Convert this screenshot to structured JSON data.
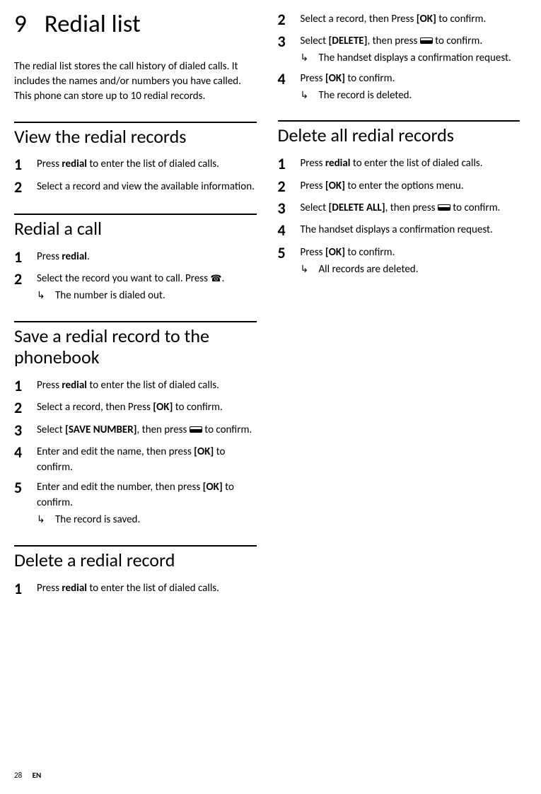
{
  "chapter": {
    "num": "9",
    "title": "Redial list"
  },
  "intro": "The redial list stores the call history of dialed calls. It includes the names and/or numbers you have called. This phone can store up to 10 redial records.",
  "s_view": {
    "title": "View the redial records",
    "step1_a": "Press ",
    "step1_b": "redial",
    "step1_c": " to enter the list of dialed calls.",
    "step2": "Select a record and view the available information."
  },
  "s_redial": {
    "title": "Redial a call",
    "step1_a": "Press ",
    "step1_b": "redial",
    "step1_c": ".",
    "step2": "Select the record you want to call. Press ",
    "step2_end": ".",
    "res": "The number is dialed out."
  },
  "s_save": {
    "title": "Save a redial record to the phonebook",
    "step1_a": "Press ",
    "step1_b": "redial",
    "step1_c": " to enter the list of dialed calls.",
    "step2_a": "Select a record, then Press ",
    "step2_b": "[OK]",
    "step2_c": " to confirm.",
    "step3_a": "Select ",
    "step3_b": "[SAVE NUMBER]",
    "step3_c": ", then press ",
    "step3_d": " to confirm.",
    "step4_a": "Enter and edit the name, then press ",
    "step4_b": "[OK]",
    "step4_c": " to confirm.",
    "step5_a": "Enter and edit the number, then press ",
    "step5_b": "[OK]",
    "step5_c": " to confirm.",
    "res": "The record is saved."
  },
  "s_del": {
    "title": "Delete a redial record",
    "step1_a": "Press ",
    "step1_b": "redial",
    "step1_c": " to enter the list of dialed calls.",
    "step2_a": "Select a record, then Press ",
    "step2_b": "[OK]",
    "step2_c": " to confirm.",
    "step3_a": "Select ",
    "step3_b": "[DELETE]",
    "step3_c": ", then press ",
    "step3_d": " to confirm.",
    "res3": "The handset displays a confirmation request.",
    "step4_a": "Press ",
    "step4_b": "[OK]",
    "step4_c": " to confirm.",
    "res4": "The record is deleted."
  },
  "s_delall": {
    "title": "Delete all redial records",
    "step1_a": "Press ",
    "step1_b": "redial",
    "step1_c": " to enter the list of dialed calls.",
    "step2_a": "Press ",
    "step2_b": "[OK]",
    "step2_c": " to enter the options menu.",
    "step3_a": "Select ",
    "step3_b": "[DELETE ALL]",
    "step3_c": ", then press ",
    "step3_d": " to confirm.",
    "step4": "The handset displays a confirmation request.",
    "step5_a": "Press ",
    "step5_b": "[OK]",
    "step5_c": " to confirm.",
    "res": "All records are deleted."
  },
  "footer": {
    "page": "28",
    "lang": "EN"
  }
}
